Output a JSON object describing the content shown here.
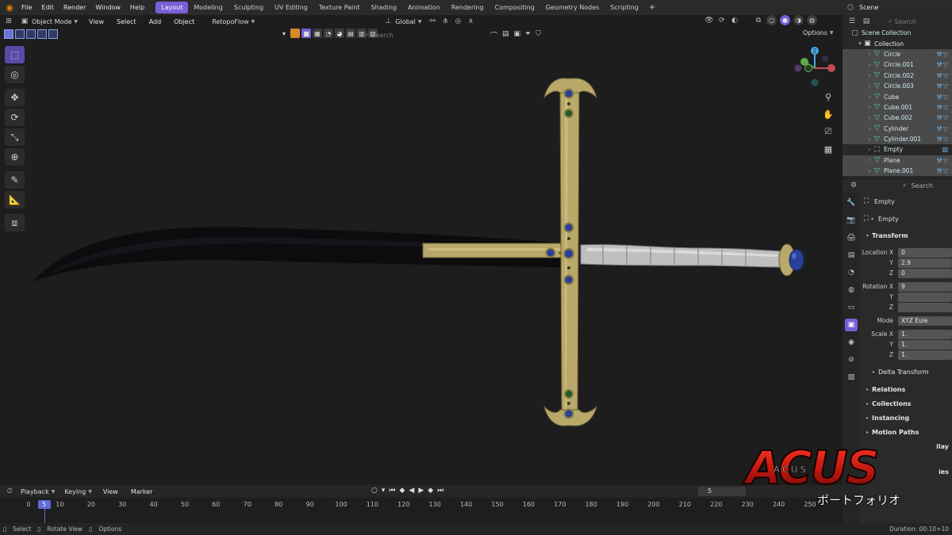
{
  "menu": {
    "items": [
      "File",
      "Edit",
      "Render",
      "Window",
      "Help"
    ]
  },
  "workspaces": {
    "tabs": [
      "Layout",
      "Modeling",
      "Sculpting",
      "UV Editing",
      "Texture Paint",
      "Shading",
      "Animation",
      "Rendering",
      "Compositing",
      "Geometry Nodes",
      "Scripting"
    ],
    "active": "Layout",
    "add_label": "+"
  },
  "scene": {
    "label": "Scene"
  },
  "viewport_header": {
    "mode": "Object Mode",
    "menus": [
      "View",
      "Select",
      "Add",
      "Object",
      "RetopoFlow"
    ],
    "orientation": "Global",
    "search_placeholder": "Search",
    "options_label": "Options"
  },
  "outliner": {
    "search_placeholder": "Search",
    "root": "Scene Collection",
    "collection": "Collection",
    "objects": [
      {
        "name": "Circle",
        "icon": "mesh-icon"
      },
      {
        "name": "Circle.001",
        "icon": "mesh-icon"
      },
      {
        "name": "Circle.002",
        "icon": "mesh-icon"
      },
      {
        "name": "Circle.003",
        "icon": "mesh-icon"
      },
      {
        "name": "Cube",
        "icon": "mesh-icon"
      },
      {
        "name": "Cube.001",
        "icon": "mesh-icon"
      },
      {
        "name": "Cube.002",
        "icon": "mesh-icon"
      },
      {
        "name": "Cylinder",
        "icon": "mesh-icon"
      },
      {
        "name": "Cylinder.001",
        "icon": "mesh-icon"
      },
      {
        "name": "Empty",
        "icon": "empty-icon"
      },
      {
        "name": "Plane",
        "icon": "mesh-icon"
      },
      {
        "name": "Plane.001",
        "icon": "mesh-icon"
      }
    ]
  },
  "properties": {
    "search_placeholder": "Search",
    "object_name": "Empty",
    "datablock_name": "Empty",
    "transform_label": "Transform",
    "location_label": "Location X",
    "y_label": "Y",
    "z_label": "Z",
    "loc_x": "0",
    "loc_y": "2.9",
    "loc_z": "0",
    "rotation_label": "Rotation X",
    "rot_x": "9",
    "rot_y": "",
    "rot_z": "",
    "mode_label": "Mode",
    "mode_value": "XYZ Eule",
    "scale_label": "Scale X",
    "scale_x": "1.",
    "scale_y": "1.",
    "scale_z": "1.",
    "delta_label": "Delta Transform",
    "panels": [
      "Relations",
      "Collections",
      "Instancing",
      "Motion Paths"
    ],
    "partial_1": "ilay",
    "partial_2": "ies"
  },
  "timeline": {
    "menus": [
      "Playback",
      "Keying",
      "View",
      "Marker"
    ],
    "current_frame": "5",
    "ticks": [
      "0",
      "10",
      "20",
      "30",
      "40",
      "50",
      "60",
      "70",
      "80",
      "90",
      "100",
      "110",
      "120",
      "130",
      "140",
      "150",
      "160",
      "170",
      "180",
      "190",
      "200",
      "210",
      "220",
      "230",
      "240",
      "250"
    ]
  },
  "status": {
    "items": [
      "Select",
      "Rotate View",
      "Options"
    ],
    "duration": "Duration: 00:10+10"
  },
  "watermark": {
    "logo": "ACUS",
    "subtitle": "ポートフォリオ",
    "letters": "A  C  U  S"
  },
  "colors": {
    "accent": "#7a5ed8",
    "timeline_cursor": "#5e6cd8",
    "blade": "#0b0b0d",
    "guard_gold": "#b8a96a",
    "gem_blue": "#2a3f9a",
    "gem_green": "#1f5a2a",
    "grip": "#c8c8c8"
  }
}
